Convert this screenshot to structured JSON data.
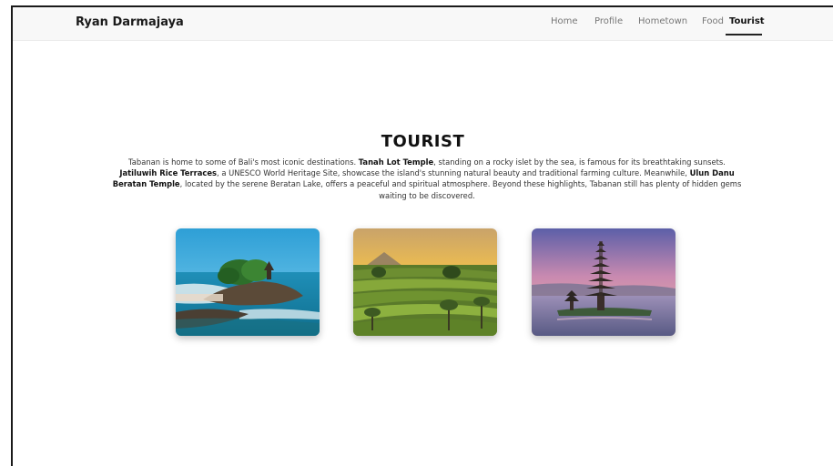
{
  "navbar": {
    "brand": "Ryan Darmajaya",
    "links": [
      {
        "label": "Home",
        "active": false
      },
      {
        "label": "Profile",
        "active": false
      },
      {
        "label": "Hometown",
        "active": false
      },
      {
        "label": "Food",
        "active": false
      },
      {
        "label": "Tourist",
        "active": true
      }
    ]
  },
  "main": {
    "title": "TOURIST",
    "description": {
      "p1": "Tabanan is home to some of Bali's most iconic destinations. ",
      "b1": "Tanah Lot Temple",
      "p2": ", standing on a rocky islet by the sea, is famous for its breathtaking sunsets. ",
      "b2": "Jatiluwih Rice Terraces",
      "p3": ", a UNESCO World Heritage Site, showcase the island's stunning natural beauty and traditional farming culture. Meanwhile, ",
      "b3": "Ulun Danu Beratan Temple",
      "p4": ", located by the serene Beratan Lake, offers a peaceful and spiritual atmosphere. Beyond these highlights, Tabanan still has plenty of hidden gems waiting to be discovered."
    },
    "gallery": [
      {
        "subject": "Tanah Lot Temple"
      },
      {
        "subject": "Jatiluwih Rice Terraces"
      },
      {
        "subject": "Ulun Danu Beratan Temple"
      }
    ]
  },
  "colors": {
    "nav_bg": "#f8f8f8",
    "text_primary": "#111111",
    "nav_muted": "#777777"
  }
}
